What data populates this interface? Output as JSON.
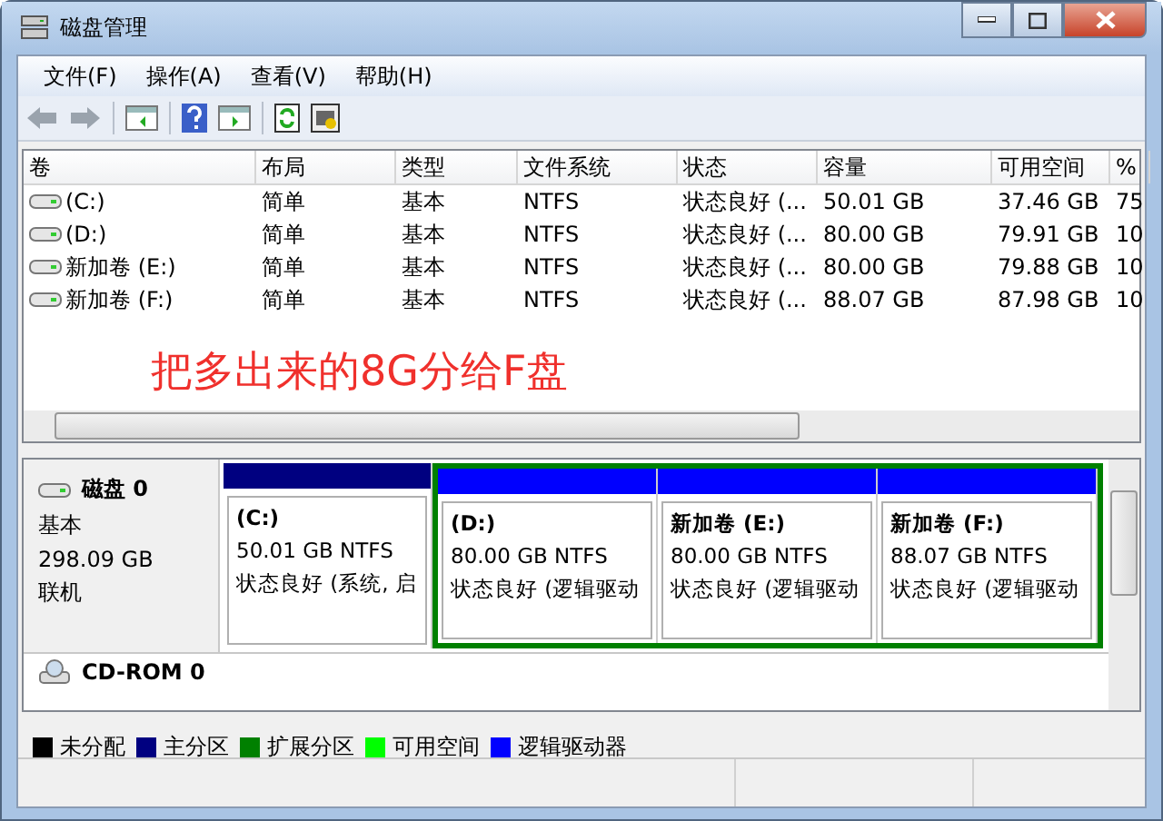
{
  "window": {
    "title": "磁盘管理"
  },
  "menu": [
    "文件(F)",
    "操作(A)",
    "查看(V)",
    "帮助(H)"
  ],
  "volume_table": {
    "columns": [
      "卷",
      "布局",
      "类型",
      "文件系统",
      "状态",
      "容量",
      "可用空间",
      "%"
    ],
    "rows": [
      [
        "(C:)",
        "简单",
        "基本",
        "NTFS",
        "状态良好 (...",
        "50.01 GB",
        "37.46 GB",
        "75"
      ],
      [
        "(D:)",
        "简单",
        "基本",
        "NTFS",
        "状态良好 (...",
        "80.00 GB",
        "79.91 GB",
        "10"
      ],
      [
        "新加卷 (E:)",
        "简单",
        "基本",
        "NTFS",
        "状态良好 (...",
        "80.00 GB",
        "79.88 GB",
        "10"
      ],
      [
        "新加卷 (F:)",
        "简单",
        "基本",
        "NTFS",
        "状态良好 (...",
        "88.07 GB",
        "87.98 GB",
        "10"
      ]
    ]
  },
  "annotation": "把多出来的8G分给F盘",
  "disks": [
    {
      "name": "磁盘 0",
      "type": "基本",
      "size": "298.09 GB",
      "status": "联机",
      "partitions": [
        {
          "kind": "primary",
          "name": "(C:)",
          "size": "50.01 GB NTFS",
          "status": "状态良好 (系统, 启"
        },
        {
          "kind": "logical",
          "name": "(D:)",
          "size": "80.00 GB NTFS",
          "status": "状态良好 (逻辑驱动"
        },
        {
          "kind": "logical",
          "name": "新加卷  (E:)",
          "size": "80.00 GB NTFS",
          "status": "状态良好 (逻辑驱动"
        },
        {
          "kind": "logical",
          "name": "新加卷  (F:)",
          "size": "88.07 GB NTFS",
          "status": "状态良好 (逻辑驱动"
        }
      ]
    },
    {
      "name": "CD-ROM 0"
    }
  ],
  "legend": [
    {
      "label": "未分配",
      "color": "#000000"
    },
    {
      "label": "主分区",
      "color": "#000080"
    },
    {
      "label": "扩展分区",
      "color": "#008000"
    },
    {
      "label": "可用空间",
      "color": "#00ff00"
    },
    {
      "label": "逻辑驱动器",
      "color": "#0000ff"
    }
  ]
}
